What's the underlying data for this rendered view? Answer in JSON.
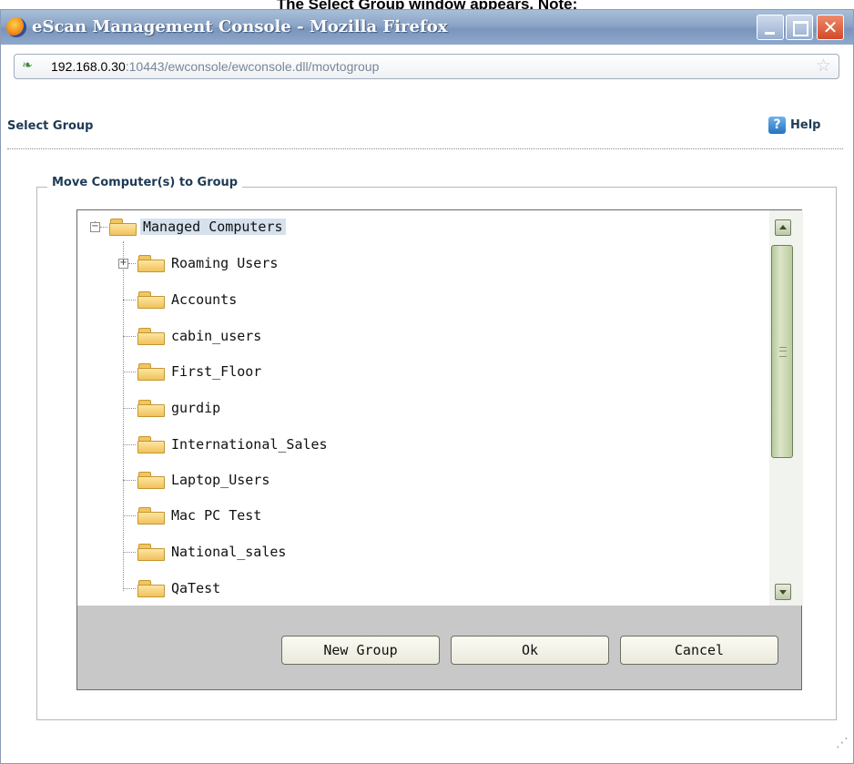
{
  "caption": "The Select Group window appears. Note:",
  "window": {
    "title": "eScan Management Console - Mozilla Firefox",
    "url_host": "192.168.0.30",
    "url_rest": ":10443/ewconsole/ewconsole.dll/movtogroup"
  },
  "header": {
    "title": "Select Group",
    "help_label": "Help"
  },
  "fieldset_legend": "Move Computer(s) to Group",
  "tree": {
    "root": "Managed Computers",
    "groups": [
      "Roaming Users",
      "Accounts",
      "cabin_users",
      "First_Floor",
      "gurdip",
      "International_Sales",
      "Laptop_Users",
      "Mac PC Test",
      "National_sales",
      "QaTest"
    ]
  },
  "buttons": {
    "new_group": "New Group",
    "ok": "Ok",
    "cancel": "Cancel"
  }
}
